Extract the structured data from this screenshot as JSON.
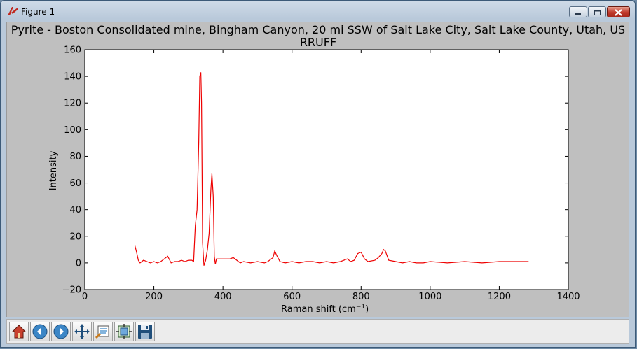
{
  "window": {
    "title": "Figure 1"
  },
  "colors": {
    "line": "#ee0000",
    "plot_bg": "#ffffff",
    "figure_bg": "#bfbfbf"
  },
  "toolbar": {
    "buttons": [
      "home-icon",
      "back-arrow-icon",
      "forward-arrow-icon",
      "pan-move-icon",
      "zoom-to-rectangle-icon",
      "configure-subplots-icon",
      "save-floppy-icon"
    ]
  },
  "chart_data": {
    "type": "line",
    "title_line1": "Pyrite - Boston Consolidated mine, Bingham Canyon, 20 mi SSW of Salt Lake City, Salt Lake County, Utah, US",
    "title_line2": "RRUFF",
    "xlabel": "Raman shift (cm",
    "xlabel_sup": "−1",
    "xlabel_end": ")",
    "ylabel": "Intensity",
    "xlim": [
      0,
      1400
    ],
    "ylim": [
      -20,
      160
    ],
    "xticks": [
      "0",
      "200",
      "400",
      "600",
      "800",
      "1000",
      "1200",
      "1400"
    ],
    "yticks": [
      "−20",
      "0",
      "20",
      "40",
      "60",
      "80",
      "100",
      "120",
      "140",
      "160"
    ],
    "grid": false,
    "x": [
      145,
      150,
      155,
      160,
      170,
      180,
      190,
      200,
      210,
      220,
      230,
      240,
      250,
      260,
      270,
      280,
      290,
      300,
      310,
      315,
      320,
      325,
      330,
      333,
      336,
      338,
      341,
      345,
      350,
      355,
      360,
      365,
      368,
      372,
      375,
      378,
      381,
      390,
      400,
      420,
      430,
      440,
      450,
      460,
      480,
      500,
      520,
      530,
      545,
      550,
      555,
      565,
      580,
      600,
      620,
      640,
      660,
      680,
      700,
      720,
      740,
      760,
      770,
      780,
      790,
      800,
      810,
      820,
      840,
      850,
      860,
      865,
      870,
      880,
      900,
      920,
      940,
      960,
      980,
      1000,
      1050,
      1100,
      1150,
      1200,
      1250,
      1270,
      1285
    ],
    "y": [
      13,
      8,
      2,
      0,
      2,
      1,
      0,
      1,
      0,
      1,
      3,
      5,
      0,
      1,
      1,
      2,
      1,
      2,
      2,
      1,
      28,
      40,
      90,
      140,
      143,
      120,
      15,
      -2,
      2,
      10,
      22,
      55,
      67,
      50,
      5,
      -1,
      3,
      3,
      3,
      3,
      4,
      2,
      0,
      1,
      0,
      1,
      0,
      1,
      4,
      9,
      6,
      1,
      0,
      1,
      0,
      1,
      1,
      0,
      1,
      0,
      1,
      3,
      1,
      2,
      7,
      8,
      3,
      1,
      2,
      4,
      7,
      10,
      9,
      2,
      1,
      0,
      1,
      0,
      0,
      1,
      0,
      1,
      0,
      1,
      1,
      1,
      1
    ]
  }
}
